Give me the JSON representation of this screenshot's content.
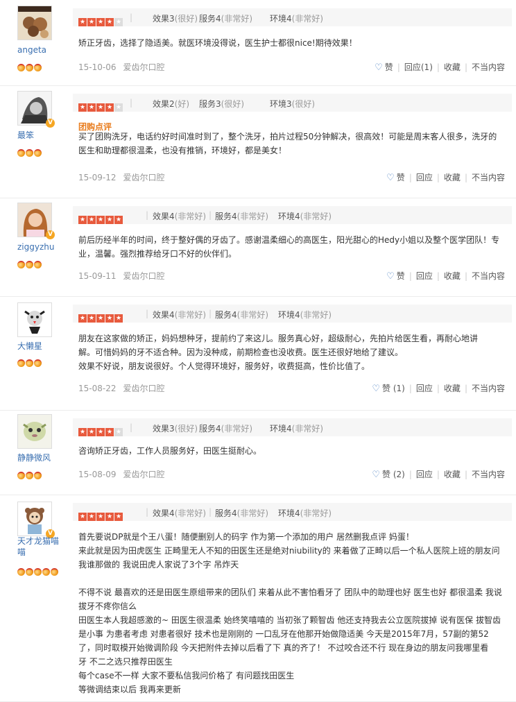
{
  "reviews": [
    {
      "user": "angeta",
      "medals": 3,
      "vip": false,
      "stars": 4,
      "s1": "效果3",
      "q1": "(很好)",
      "s2": "服务4",
      "q2": "(非常好)",
      "s3": "环境4",
      "q3": "(非常好)",
      "tuan": "",
      "content": "矫正牙齿，选择了隐适美。就医环境没得说，医生护士都很nice!期待效果！",
      "date": "15-10-06",
      "shop": "爱齿尔口腔",
      "like": "赞",
      "reply": "回应",
      "reply_count": "(1)",
      "like_count": "",
      "fav": "收藏",
      "report": "不当内容"
    },
    {
      "user": "最笨",
      "medals": 3,
      "vip": true,
      "stars": 4,
      "s1": "效果2",
      "q1": "(好)",
      "s2": "服务3",
      "q2": "(很好)",
      "s3": "环境3",
      "q3": "(很好)",
      "tuan": "团购点评",
      "content": "买了团购洗牙，电话约好时间准时到了，整个洗牙，拍片过程50分钟解决，很高效！可能是周末客人很多，洗牙的\n医生和助理都很温柔，也没有推销，环境好，都是美女！",
      "date": "15-09-12",
      "shop": "爱齿尔口腔",
      "like": "赞",
      "reply": "回应",
      "reply_count": "",
      "like_count": "",
      "fav": "收藏",
      "report": "不当内容"
    },
    {
      "user": "ziggyzhu",
      "medals": 3,
      "vip": true,
      "stars": 5,
      "s1": "效果4",
      "q1": "(非常好)",
      "s2": "服务4",
      "q2": "(非常好)",
      "s3": "环境4",
      "q3": "(非常好)",
      "tuan": "",
      "content": "前后历经半年的时间，终于整好偶的牙齿了。感谢温柔细心的高医生，阳光甜心的Hedy小姐以及整个医学团队！专\n业，温馨。强烈推荐给牙口不好的伙伴们。",
      "date": "15-09-11",
      "shop": "爱齿尔口腔",
      "like": "赞",
      "reply": "回应",
      "reply_count": "",
      "like_count": "",
      "fav": "收藏",
      "report": "不当内容"
    },
    {
      "user": "大懒星",
      "medals": 3,
      "vip": false,
      "stars": 5,
      "s1": "效果4",
      "q1": "(非常好)",
      "s2": "服务4",
      "q2": "(非常好)",
      "s3": "环境4",
      "q3": "(非常好)",
      "tuan": "",
      "content": "朋友在这家做的矫正，妈妈想种牙，提前约了来这儿。服务真心好，超级耐心，先拍片给医生看，再耐心地讲\n解。可惜妈妈的牙不适合种。因为没种成，前期检查也没收费。医生还很好地给了建议。\n效果不好说，朋友说很好。个人觉得环境好，服务好，收费挺高，性价比值了。",
      "date": "15-08-22",
      "shop": "爱齿尔口腔",
      "like": "赞",
      "reply": "回应",
      "reply_count": "",
      "like_count": "(1)",
      "fav": "收藏",
      "report": "不当内容"
    },
    {
      "user": "静静微风",
      "medals": 3,
      "vip": false,
      "stars": 4,
      "s1": "效果3",
      "q1": "(很好)",
      "s2": "服务4",
      "q2": "(非常好)",
      "s3": "环境4",
      "q3": "(非常好)",
      "tuan": "",
      "content": "咨询矫正牙齿，工作人员服务好，田医生挺耐心。",
      "date": "15-08-09",
      "shop": "爱齿尔口腔",
      "like": "赞",
      "reply": "回应",
      "reply_count": "",
      "like_count": "(2)",
      "fav": "收藏",
      "report": "不当内容"
    },
    {
      "user": "天才龙猫喵\n喵",
      "medals": 5,
      "vip": true,
      "stars": 5,
      "s1": "效果4",
      "q1": "(非常好)",
      "s2": "服务4",
      "q2": "(非常好)",
      "s3": "环境4",
      "q3": "(非常好)",
      "tuan": "",
      "content": "首先要说DP就是个王八蛋！随便删别人的码字 作为第一个添加的用户 居然删我点评 妈蛋！\n来此就是因为田虎医生 正畸里无人不知的田医生还是绝对niubility的 来着做了正畸以后一个私人医院上班的朋友问\n我谁那做的 我说田虎人家说了3个字 吊炸天\n\n不得不说 最喜欢的还是田医生原组带来的团队们 来着从此不害怕看牙了 团队中的助理也好 医生也好 都很温柔 我说\n拔牙不疼你信么\n田医生本人我超感激的~ 田医生很温柔 始终笑嘻嘻的 当初张了颗智齿 他还支持我去公立医院拔掉 说有医保 拔智齿\n是小事 为患者考虑 对患者很好 技术也是刚刚的 一口乱牙在他那开始做隐适美 今天是2015年7月，57副的第52\n了，同时取模开始微调阶段 今天把附件去掉以后看了下 真的齐了！ 不过咬合还不行 现在身边的朋友问我哪里看\n牙 不二之选只推荐田医生\n每个case不一样 大家不要私信我问价格了 有问题找田医生\n等微调结束以后 我再来更新",
      "date": "",
      "shop": "",
      "like": "",
      "reply": "",
      "reply_count": "",
      "like_count": "",
      "fav": "",
      "report": ""
    }
  ],
  "colors": {
    "star": "#e85a3d",
    "username": "#3a6fb0",
    "tuan": "#e87b1b",
    "heart": "#4a7fc1"
  },
  "icons": {
    "like": "heart-icon",
    "vip": "vip-badge-icon",
    "medal": "medal-icon"
  }
}
